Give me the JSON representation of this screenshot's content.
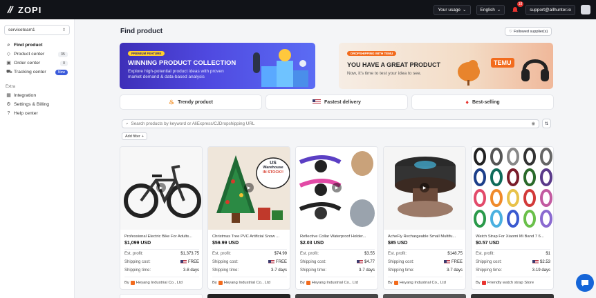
{
  "app": {
    "logo": "ZOPI"
  },
  "topbar": {
    "usage_label": "Your usage",
    "language": "English",
    "notif_count": "18",
    "user_email": "support@allhunter.io"
  },
  "sidebar": {
    "team": "serviceteam1",
    "items": [
      {
        "label": "Find product",
        "icon": "search-icon",
        "count": ""
      },
      {
        "label": "Product center",
        "icon": "tag-icon",
        "count": "35"
      },
      {
        "label": "Order center",
        "icon": "box-icon",
        "count": "0"
      },
      {
        "label": "Tracking center",
        "icon": "truck-icon",
        "count": "New"
      }
    ],
    "extra_label": "Extra",
    "extra_items": [
      {
        "label": "Integration",
        "icon": "grid-icon"
      },
      {
        "label": "Settings & Billing",
        "icon": "gear-icon"
      },
      {
        "label": "Help center",
        "icon": "help-icon"
      }
    ]
  },
  "main": {
    "title": "Find product",
    "followed_label": "Followed supplier(s)",
    "banner1": {
      "tag": "PREMIUM FEATURE",
      "title": "WINNING PRODUCT COLLECTION",
      "subtitle": "Explore high-potential product ideas with proven market demand & data-based analysis"
    },
    "banner2": {
      "tag": "DROPSHIPPING WITH TEMU",
      "title": "YOU HAVE A GREAT PRODUCT",
      "subtitle": "Now, it's time to test your idea to see.",
      "brand": "TEMU"
    },
    "tabs": [
      {
        "label": "Trendy product",
        "icon": "fire-person-icon"
      },
      {
        "label": "Fastest delivery",
        "icon": "us-flag-icon"
      },
      {
        "label": "Best-selling",
        "icon": "flame-icon"
      }
    ],
    "search_placeholder": "Search products by keyword or AliExpress/CJDropshipping URL",
    "add_filter": "Add filter",
    "labels": {
      "est_profit": "Est. profit:",
      "shipping_cost": "Shipping cost:",
      "shipping_time": "Shipping time:",
      "by": "By"
    },
    "products": [
      {
        "title": "Professional Electric Bike For Adults...",
        "price": "$1,099 USD",
        "profit": "$1,373.75",
        "shipping_cost": "FREE",
        "shipping_time": "3-8 days",
        "supplier": "Heyang Industrial Co., Ltd"
      },
      {
        "title": "Christmas Tree PVC Artificial Snow ...",
        "price": "$59.99 USD",
        "profit": "$74.99",
        "shipping_cost": "FREE",
        "shipping_time": "3-7 days",
        "supplier": "Heyang Industrial Co., Ltd",
        "overlay": [
          "US",
          "Warehouse",
          "IN STOCK!!"
        ]
      },
      {
        "title": "Reflective Collar Waterproof Holder...",
        "price": "$2.03 USD",
        "profit": "$3.55",
        "shipping_cost": "$4.77",
        "shipping_time": "3-7 days",
        "supplier": "Heyang Industrial Co., Ltd"
      },
      {
        "title": "AcheFly Rechargeable Small Multifu...",
        "price": "$85 USD",
        "profit": "$148.75",
        "shipping_cost": "FREE",
        "shipping_time": "3-7 days",
        "supplier": "Heyang Industrial Co., Ltd"
      },
      {
        "title": "Watch Strap For Xiaomi Mi Band 7 6...",
        "price": "$0.57 USD",
        "profit": "$1",
        "shipping_cost": "$2.53",
        "shipping_time": "3-19 days",
        "supplier": "Friendly watch strap Store"
      }
    ]
  }
}
